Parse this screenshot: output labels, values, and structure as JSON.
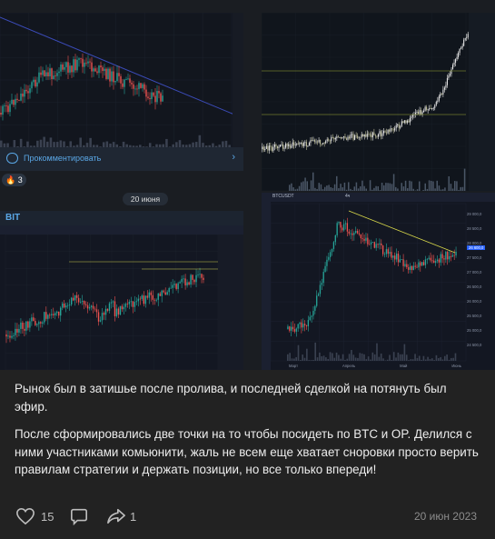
{
  "comment_label": "Прокомментировать",
  "reaction": {
    "emoji": "🔥",
    "count": "3"
  },
  "date_separator": "20 июня",
  "channel_badge": "BIT",
  "post_text": {
    "paragraph1": "Рынок был в затишье после пролива, и последней сделкой на потянуть был эфир.",
    "paragraph2": "После сформировались две точки на то чтобы посидеть по BTC и OP. Делился с ними участниками комьюнити, жаль не всем еще хватает сноровки просто верить правилам стратегии и держать позиции, но все только впереди!"
  },
  "actions": {
    "likes": "15",
    "shares": "1"
  },
  "post_date": "20 июн 2023",
  "chart4": {
    "ticker": "BTCUSDT",
    "interval": "4ч",
    "prices": [
      "29 000,0",
      "28 500,0",
      "28 000,0",
      "27 500,0",
      "27 000,0",
      "26 500,0",
      "26 000,0",
      "25 500,0",
      "25 000,0",
      "24 500,0"
    ],
    "current": "26 600,0",
    "months": [
      "Март",
      "Апрель",
      "Май",
      "Июнь"
    ]
  },
  "colors": {
    "up": "#26a69a",
    "down": "#ef5350",
    "link": "#5aa7e6",
    "bg": "#222222"
  }
}
